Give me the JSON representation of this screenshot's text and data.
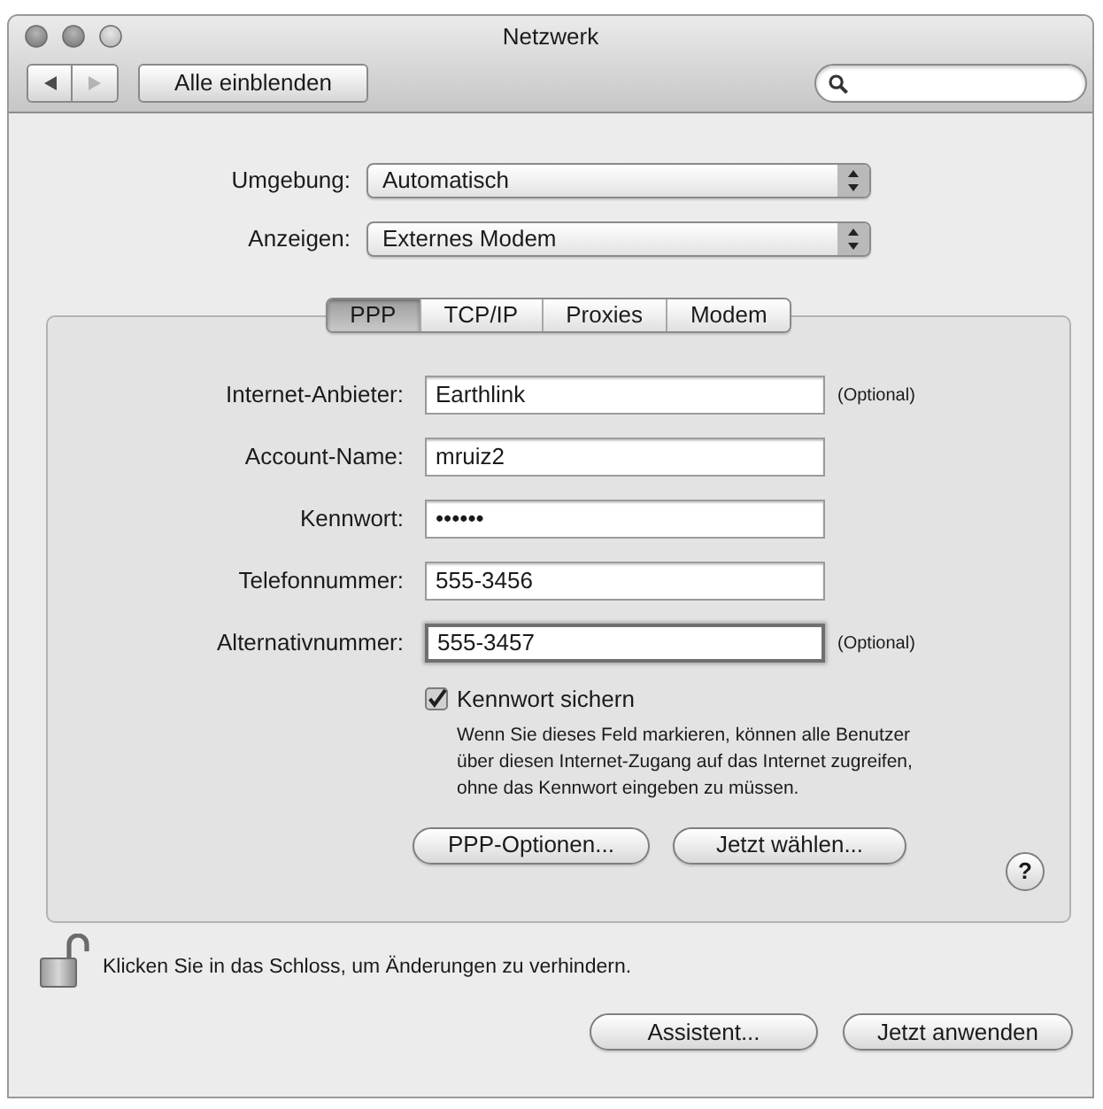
{
  "window": {
    "title": "Netzwerk"
  },
  "toolbar": {
    "nav_buttons": [
      {
        "kind": "back",
        "disabled": false
      },
      {
        "kind": "forward",
        "disabled": true
      }
    ],
    "show_all_button": "Alle einblenden"
  },
  "popups": [
    {
      "label": "Umgebung:",
      "value": "Automatisch"
    },
    {
      "label": "Anzeigen:",
      "value": "Externes Modem"
    }
  ],
  "tabs": [
    {
      "label": "PPP",
      "selected": true
    },
    {
      "label": "TCP/IP",
      "selected": false
    },
    {
      "label": "Proxies",
      "selected": false
    },
    {
      "label": "Modem",
      "selected": false
    }
  ],
  "fields": [
    {
      "label": "Internet-Anbieter:",
      "value": "Earthlink",
      "note": "(Optional)",
      "focused": false
    },
    {
      "label": "Account-Name:",
      "value": "mruiz2",
      "focused": false
    },
    {
      "label": "Kennwort:",
      "value": "••••••",
      "focused": false
    },
    {
      "label": "Telefonnummer:",
      "value": "555-3456",
      "focused": false
    },
    {
      "label": "Alternativnummer:",
      "value": "555-3457",
      "note": "(Optional)",
      "focused": true
    }
  ],
  "save_password": {
    "label": "Kennwort sichern",
    "checked": true,
    "description": [
      "Wenn Sie dieses Feld markieren, können alle Benutzer",
      "über diesen Internet-Zugang auf das Internet zugreifen,",
      "ohne das Kennwort eingeben zu müssen."
    ]
  },
  "panel_buttons": [
    "PPP-Optionen...",
    "Jetzt wählen..."
  ],
  "help_button": "?",
  "lock": {
    "locked": false,
    "message": "Klicken Sie in das Schloss, um Änderungen zu verhindern."
  },
  "footer_buttons": [
    "Assistent...",
    "Jetzt anwenden"
  ]
}
